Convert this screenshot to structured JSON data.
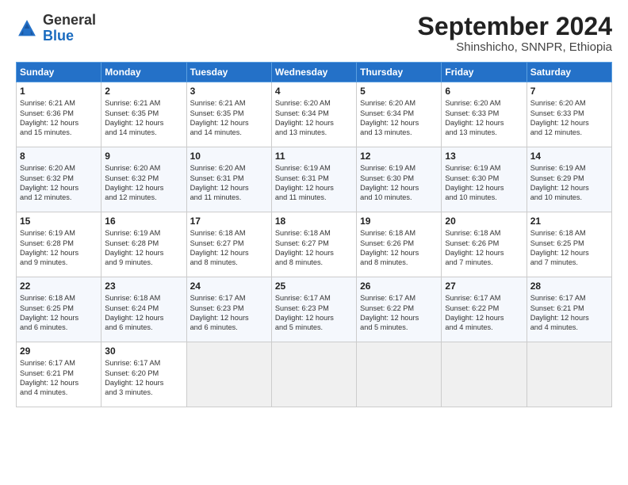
{
  "logo": {
    "general": "General",
    "blue": "Blue"
  },
  "header": {
    "month": "September 2024",
    "location": "Shinshicho, SNNPR, Ethiopia"
  },
  "weekdays": [
    "Sunday",
    "Monday",
    "Tuesday",
    "Wednesday",
    "Thursday",
    "Friday",
    "Saturday"
  ],
  "weeks": [
    [
      {
        "day": "1",
        "info": "Sunrise: 6:21 AM\nSunset: 6:36 PM\nDaylight: 12 hours\nand 15 minutes."
      },
      {
        "day": "2",
        "info": "Sunrise: 6:21 AM\nSunset: 6:35 PM\nDaylight: 12 hours\nand 14 minutes."
      },
      {
        "day": "3",
        "info": "Sunrise: 6:21 AM\nSunset: 6:35 PM\nDaylight: 12 hours\nand 14 minutes."
      },
      {
        "day": "4",
        "info": "Sunrise: 6:20 AM\nSunset: 6:34 PM\nDaylight: 12 hours\nand 13 minutes."
      },
      {
        "day": "5",
        "info": "Sunrise: 6:20 AM\nSunset: 6:34 PM\nDaylight: 12 hours\nand 13 minutes."
      },
      {
        "day": "6",
        "info": "Sunrise: 6:20 AM\nSunset: 6:33 PM\nDaylight: 12 hours\nand 13 minutes."
      },
      {
        "day": "7",
        "info": "Sunrise: 6:20 AM\nSunset: 6:33 PM\nDaylight: 12 hours\nand 12 minutes."
      }
    ],
    [
      {
        "day": "8",
        "info": "Sunrise: 6:20 AM\nSunset: 6:32 PM\nDaylight: 12 hours\nand 12 minutes."
      },
      {
        "day": "9",
        "info": "Sunrise: 6:20 AM\nSunset: 6:32 PM\nDaylight: 12 hours\nand 12 minutes."
      },
      {
        "day": "10",
        "info": "Sunrise: 6:20 AM\nSunset: 6:31 PM\nDaylight: 12 hours\nand 11 minutes."
      },
      {
        "day": "11",
        "info": "Sunrise: 6:19 AM\nSunset: 6:31 PM\nDaylight: 12 hours\nand 11 minutes."
      },
      {
        "day": "12",
        "info": "Sunrise: 6:19 AM\nSunset: 6:30 PM\nDaylight: 12 hours\nand 10 minutes."
      },
      {
        "day": "13",
        "info": "Sunrise: 6:19 AM\nSunset: 6:30 PM\nDaylight: 12 hours\nand 10 minutes."
      },
      {
        "day": "14",
        "info": "Sunrise: 6:19 AM\nSunset: 6:29 PM\nDaylight: 12 hours\nand 10 minutes."
      }
    ],
    [
      {
        "day": "15",
        "info": "Sunrise: 6:19 AM\nSunset: 6:28 PM\nDaylight: 12 hours\nand 9 minutes."
      },
      {
        "day": "16",
        "info": "Sunrise: 6:19 AM\nSunset: 6:28 PM\nDaylight: 12 hours\nand 9 minutes."
      },
      {
        "day": "17",
        "info": "Sunrise: 6:18 AM\nSunset: 6:27 PM\nDaylight: 12 hours\nand 8 minutes."
      },
      {
        "day": "18",
        "info": "Sunrise: 6:18 AM\nSunset: 6:27 PM\nDaylight: 12 hours\nand 8 minutes."
      },
      {
        "day": "19",
        "info": "Sunrise: 6:18 AM\nSunset: 6:26 PM\nDaylight: 12 hours\nand 8 minutes."
      },
      {
        "day": "20",
        "info": "Sunrise: 6:18 AM\nSunset: 6:26 PM\nDaylight: 12 hours\nand 7 minutes."
      },
      {
        "day": "21",
        "info": "Sunrise: 6:18 AM\nSunset: 6:25 PM\nDaylight: 12 hours\nand 7 minutes."
      }
    ],
    [
      {
        "day": "22",
        "info": "Sunrise: 6:18 AM\nSunset: 6:25 PM\nDaylight: 12 hours\nand 6 minutes."
      },
      {
        "day": "23",
        "info": "Sunrise: 6:18 AM\nSunset: 6:24 PM\nDaylight: 12 hours\nand 6 minutes."
      },
      {
        "day": "24",
        "info": "Sunrise: 6:17 AM\nSunset: 6:23 PM\nDaylight: 12 hours\nand 6 minutes."
      },
      {
        "day": "25",
        "info": "Sunrise: 6:17 AM\nSunset: 6:23 PM\nDaylight: 12 hours\nand 5 minutes."
      },
      {
        "day": "26",
        "info": "Sunrise: 6:17 AM\nSunset: 6:22 PM\nDaylight: 12 hours\nand 5 minutes."
      },
      {
        "day": "27",
        "info": "Sunrise: 6:17 AM\nSunset: 6:22 PM\nDaylight: 12 hours\nand 4 minutes."
      },
      {
        "day": "28",
        "info": "Sunrise: 6:17 AM\nSunset: 6:21 PM\nDaylight: 12 hours\nand 4 minutes."
      }
    ],
    [
      {
        "day": "29",
        "info": "Sunrise: 6:17 AM\nSunset: 6:21 PM\nDaylight: 12 hours\nand 4 minutes."
      },
      {
        "day": "30",
        "info": "Sunrise: 6:17 AM\nSunset: 6:20 PM\nDaylight: 12 hours\nand 3 minutes."
      },
      {
        "day": "",
        "info": ""
      },
      {
        "day": "",
        "info": ""
      },
      {
        "day": "",
        "info": ""
      },
      {
        "day": "",
        "info": ""
      },
      {
        "day": "",
        "info": ""
      }
    ]
  ]
}
